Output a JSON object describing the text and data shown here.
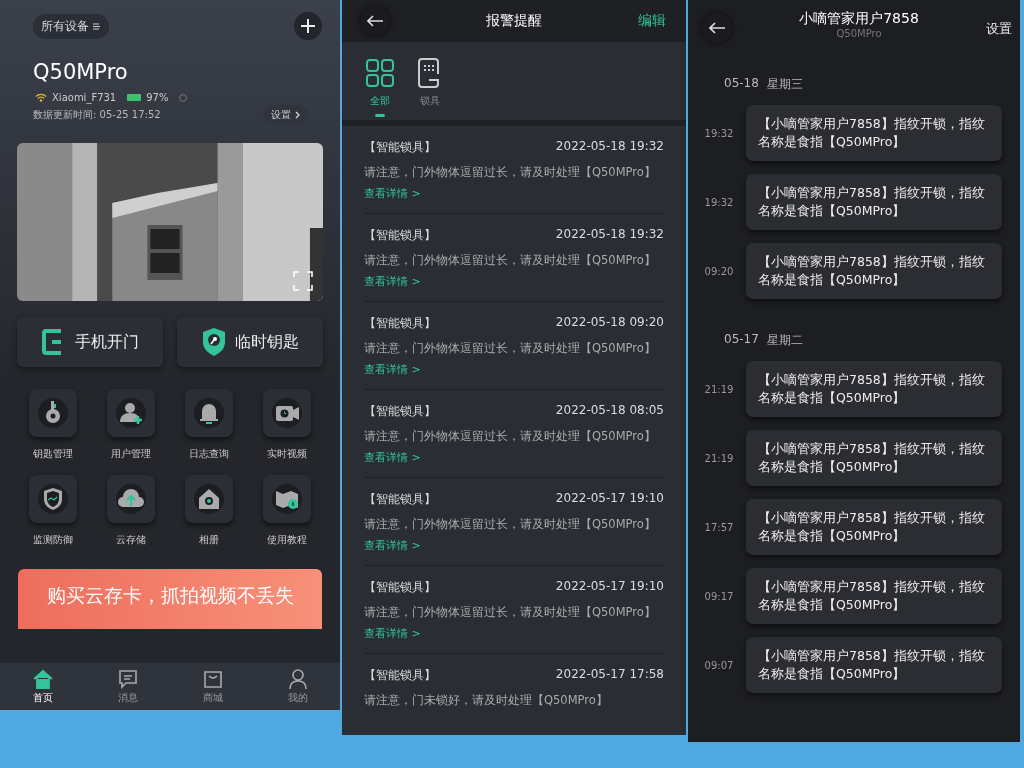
{
  "home": {
    "device_menu": "所有设备",
    "device_name": "Q50MPro",
    "wifi": "Xiaomi_F731",
    "battery": "97%",
    "settings": "设置",
    "updated": "数据更新时间: 05-25 17:52",
    "camera": {
      "kind": "picture"
    },
    "actions": [
      "手机开门",
      "临时钥匙"
    ],
    "features": [
      "钥匙管理",
      "用户管理",
      "日志查询",
      "实时视频",
      "监测防御",
      "云存储",
      "相册",
      "使用教程"
    ],
    "banner": "购买云存卡，抓拍视频不丢失",
    "nav": [
      {
        "label": "首页",
        "selected": true
      },
      {
        "label": "消息",
        "selected": false
      },
      {
        "label": "商城",
        "selected": false
      },
      {
        "label": "我的",
        "selected": false
      }
    ]
  },
  "alerts": {
    "title": "报警提醒",
    "edit": "编辑",
    "tabs": [
      {
        "label": "全部",
        "selected": true
      },
      {
        "label": "锁具",
        "selected": false
      }
    ],
    "items": [
      {
        "source": "【智能锁具】",
        "time": "2022-05-18 19:32",
        "message": "请注意，门外物体逗留过长，请及时处理【Q50MPro】",
        "link": "查看详情 >"
      },
      {
        "source": "【智能锁具】",
        "time": "2022-05-18 19:32",
        "message": "请注意，门外物体逗留过长，请及时处理【Q50MPro】",
        "link": "查看详情 >"
      },
      {
        "source": "【智能锁具】",
        "time": "2022-05-18 09:20",
        "message": "请注意，门外物体逗留过长，请及时处理【Q50MPro】",
        "link": "查看详情 >"
      },
      {
        "source": "【智能锁具】",
        "time": "2022-05-18 08:05",
        "message": "请注意，门外物体逗留过长，请及时处理【Q50MPro】",
        "link": "查看详情 >"
      },
      {
        "source": "【智能锁具】",
        "time": "2022-05-17 19:10",
        "message": "请注意，门外物体逗留过长，请及时处理【Q50MPro】",
        "link": "查看详情 >"
      },
      {
        "source": "【智能锁具】",
        "time": "2022-05-17 19:10",
        "message": "请注意，门外物体逗留过长，请及时处理【Q50MPro】",
        "link": "查看详情 >"
      },
      {
        "source": "【智能锁具】",
        "time": "2022-05-17 17:58",
        "message": "请注意，门未锁好，请及时处理【Q50MPro】"
      }
    ]
  },
  "chat": {
    "title": "小嘀管家用户7858",
    "subtitle": "Q50MPro",
    "settings": "设置",
    "days": [
      {
        "date": "05-18",
        "weekday": "星期三",
        "messages": [
          {
            "time": "19:32",
            "text": "【小嘀管家用户7858】指纹开锁，指纹名称是食指【Q50MPro】"
          },
          {
            "time": "19:32",
            "text": "【小嘀管家用户7858】指纹开锁，指纹名称是食指【Q50MPro】"
          },
          {
            "time": "09:20",
            "text": "【小嘀管家用户7858】指纹开锁，指纹名称是食指【Q50MPro】"
          }
        ]
      },
      {
        "date": "05-17",
        "weekday": "星期二",
        "messages": [
          {
            "time": "21:19",
            "text": "【小嘀管家用户7858】指纹开锁，指纹名称是食指【Q50MPro】"
          },
          {
            "time": "21:19",
            "text": "【小嘀管家用户7858】指纹开锁，指纹名称是食指【Q50MPro】"
          },
          {
            "time": "17:57",
            "text": "【小嘀管家用户7858】指纹开锁，指纹名称是食指【Q50MPro】"
          },
          {
            "time": "09:17",
            "text": "【小嘀管家用户7858】指纹开锁，指纹名称是食指【Q50MPro】"
          },
          {
            "time": "09:07",
            "text": "【小嘀管家用户7858】指纹开锁，指纹名称是食指【Q50MPro】"
          }
        ]
      }
    ]
  }
}
